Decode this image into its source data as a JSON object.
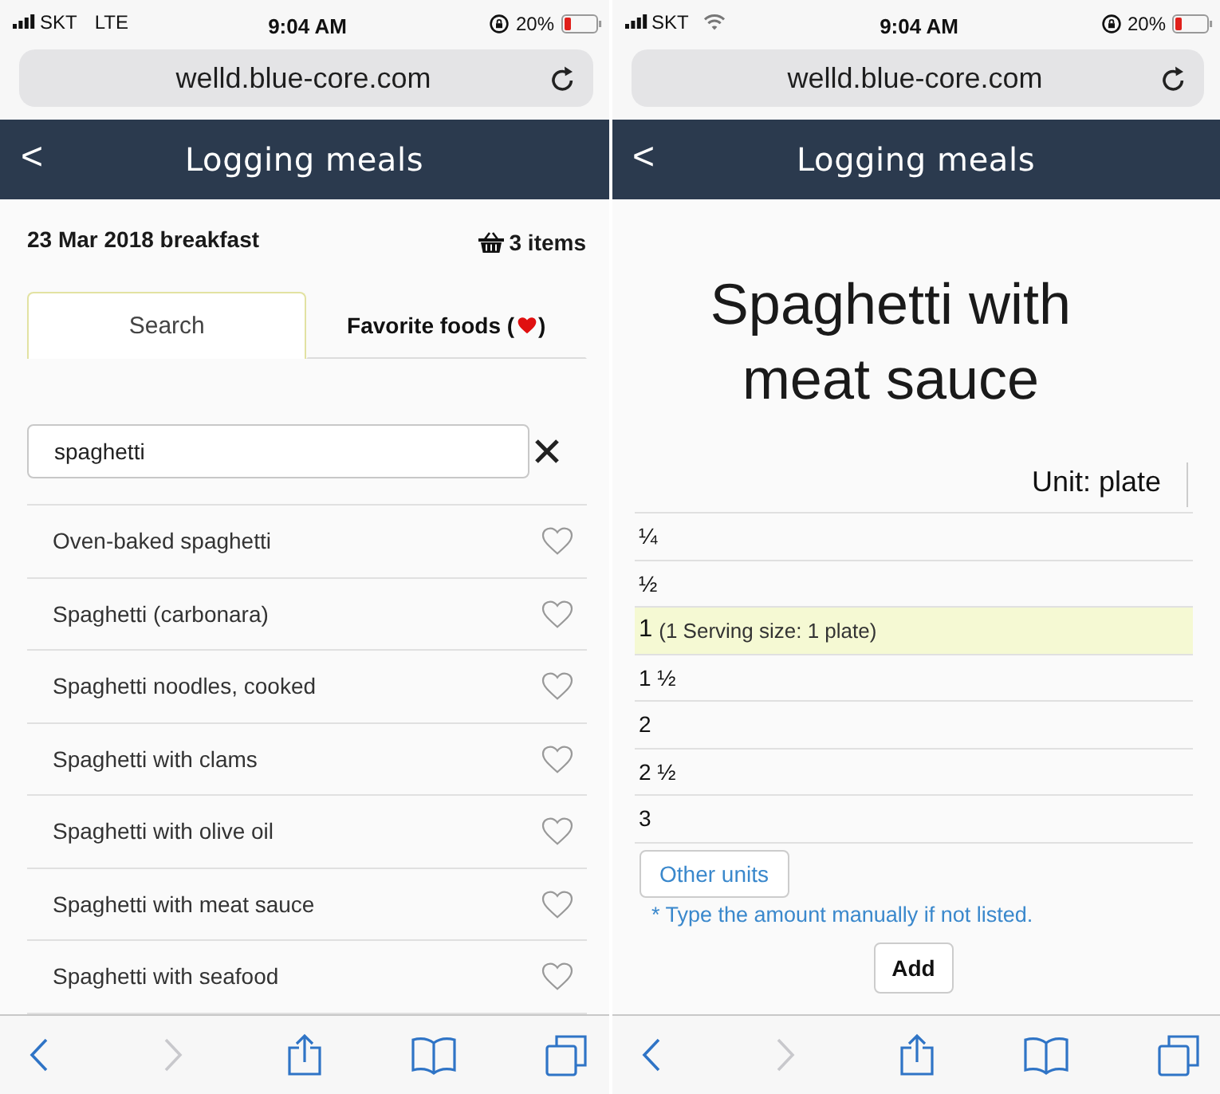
{
  "screens": [
    {
      "kind": "food_search",
      "status_bar": {
        "carrier": "SKT",
        "network": {
          "kind": "cellular",
          "label": "LTE"
        },
        "time": "9:04 AM",
        "battery": "20%"
      },
      "address_bar": {
        "url": "welld.blue-core.com"
      },
      "header": {
        "back": "<",
        "title": "Logging meals"
      },
      "meal": {
        "title": "23 Mar 2018 breakfast",
        "basket": "3 items"
      },
      "tabs": [
        {
          "kind": "plain",
          "label": "Search",
          "selected": true
        },
        {
          "kind": "favorites",
          "label": "Favorite foods (",
          "label_end": ")",
          "selected": false
        }
      ],
      "search": {
        "value": "spaghetti"
      },
      "foods": [
        {
          "name": "Oven-baked spaghetti",
          "favorite": false
        },
        {
          "name": "Spaghetti (carbonara)",
          "favorite": false
        },
        {
          "name": "Spaghetti noodles, cooked",
          "favorite": false
        },
        {
          "name": "Spaghetti with clams",
          "favorite": false
        },
        {
          "name": "Spaghetti with olive oil",
          "favorite": false
        },
        {
          "name": "Spaghetti with meat sauce",
          "favorite": false
        },
        {
          "name": "Spaghetti with seafood",
          "favorite": false
        }
      ],
      "toolbar": {
        "back": {
          "disabled": false
        },
        "forward": {
          "disabled": true
        }
      }
    },
    {
      "kind": "portion",
      "status_bar": {
        "carrier": "SKT",
        "network": {
          "kind": "wifi"
        },
        "time": "9:04 AM",
        "battery": "20%"
      },
      "address_bar": {
        "url": "welld.blue-core.com"
      },
      "header": {
        "back": "<",
        "title": "Logging meals"
      },
      "food_title": "Spaghetti with meat sauce",
      "unit": "Unit: plate",
      "amounts": [
        {
          "amount": "¼",
          "selected": false
        },
        {
          "amount": "½",
          "selected": false
        },
        {
          "amount": "1",
          "note": "(1 Serving size: 1 plate)",
          "selected": true
        },
        {
          "amount": "1 ½",
          "selected": false
        },
        {
          "amount": "2",
          "selected": false
        },
        {
          "amount": "2 ½",
          "selected": false
        },
        {
          "amount": "3",
          "selected": false
        }
      ],
      "other_units": "Other units",
      "hint": "* Type the amount manually if not listed.",
      "add": "Add",
      "toolbar": {
        "back": {
          "disabled": false
        },
        "forward": {
          "disabled": true
        }
      }
    }
  ]
}
